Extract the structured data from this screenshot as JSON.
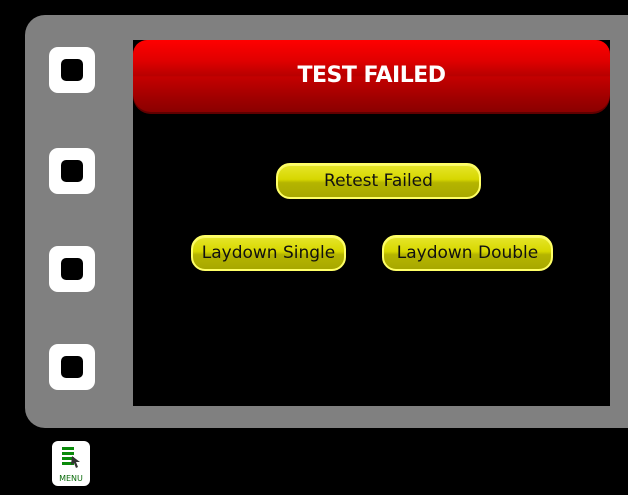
{
  "dialog": {
    "title": "TEST FAILED",
    "title_color": "#ff0000"
  },
  "actions": {
    "retest_label": "Retest Failed",
    "laydown_single_label": "Laydown Single",
    "laydown_double_label": "Laydown Double",
    "button_color": "#d7d700"
  },
  "side_buttons": [
    {
      "icon": "square-key-icon"
    },
    {
      "icon": "square-key-icon"
    },
    {
      "icon": "square-key-icon"
    },
    {
      "icon": "square-key-icon"
    }
  ],
  "menu": {
    "label": "MENU",
    "icon": "menu-list-icon",
    "icon_color": "#0a8a0a"
  }
}
